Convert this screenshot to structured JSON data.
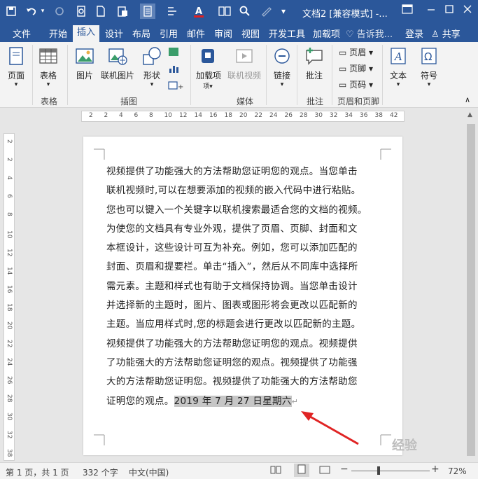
{
  "window": {
    "title": "文档2 [兼容模式] -...",
    "restore_icon": "restore-ribbon-icon"
  },
  "quick_access": {
    "save": "save-icon",
    "undo": "undo-icon",
    "redo": "redo-icon",
    "print_preview": "print-preview-icon",
    "new": "new-doc-icon",
    "paste": "paste-icon",
    "layout": "layout-icon",
    "indent": "indent-icon",
    "font_color": "font-color-icon",
    "two_pages": "two-pages-icon",
    "find": "find-icon",
    "draw": "draw-icon"
  },
  "tabs": [
    {
      "label": "文件"
    },
    {
      "label": "开始"
    },
    {
      "label": "插入"
    },
    {
      "label": "设计"
    },
    {
      "label": "布局"
    },
    {
      "label": "引用"
    },
    {
      "label": "邮件"
    },
    {
      "label": "审阅"
    },
    {
      "label": "视图"
    },
    {
      "label": "开发工具"
    },
    {
      "label": "加载项"
    }
  ],
  "tell_me": "告诉我...",
  "sign_in": "登录",
  "share": "共享",
  "ribbon": {
    "page": "页面",
    "table": "表格",
    "table_group": "表格",
    "picture": "图片",
    "online_picture": "联机图片",
    "shape": "形状",
    "illustration_group": "插图",
    "addins": "加载项",
    "online_video": "联机视频",
    "media_group": "媒体",
    "link": "链接",
    "comment": "批注",
    "comment_group": "批注",
    "header": "页眉",
    "footer": "页脚",
    "page_number": "页码",
    "header_footer_group": "页眉和页脚",
    "textbox": "文本",
    "symbol": "符号"
  },
  "ruler": {
    "h_ticks": [
      "2",
      "2",
      "4",
      "6",
      "8",
      "10",
      "12",
      "14",
      "16",
      "18",
      "20",
      "22",
      "24",
      "26",
      "28",
      "30",
      "32",
      "34",
      "36",
      "38",
      "42"
    ],
    "v_ticks": [
      "2",
      "2",
      "4",
      "6",
      "8",
      "10",
      "12",
      "14",
      "16",
      "18",
      "20",
      "22",
      "24",
      "26",
      "28",
      "30",
      "32",
      "38"
    ]
  },
  "document": {
    "lines": [
      "视频提供了功能强大的方法帮助您证明您的观点。当您单击",
      "联机视频时,可以在想要添加的视频的嵌入代码中进行粘贴。",
      "您也可以键入一个关键字以联机搜索最适合您的文档的视频。",
      "为使您的文档具有专业外观，提供了页眉、页脚、封面和文",
      "本框设计，这些设计可互为补充。例如，您可以添加匹配的",
      "封面、页眉和提要栏。单击“插入”，然后从不同库中选择所",
      "需元素。主题和样式也有助于文档保持协调。当您单击设计",
      "并选择新的主题时，图片、图表或图形将会更改以匹配新的",
      "主题。当应用样式时,您的标题会进行更改以匹配新的主题。",
      "视频提供了功能强大的方法帮助您证明您的观点。视频提供",
      "了功能强大的方法帮助您证明您的观点。视频提供了功能强",
      "大的方法帮助您证明您。视频提供了功能强大的方法帮助您"
    ],
    "last_line_text": "证明您的观点。",
    "selected_date": "2019 年 7 月 27 日星期六"
  },
  "status": {
    "page": "第 1 页，共 1 页",
    "words": "332 个字",
    "language": "中文(中国)",
    "zoom": "72%",
    "zoom_minus": "−",
    "zoom_plus": "+"
  },
  "watermark": "经验"
}
